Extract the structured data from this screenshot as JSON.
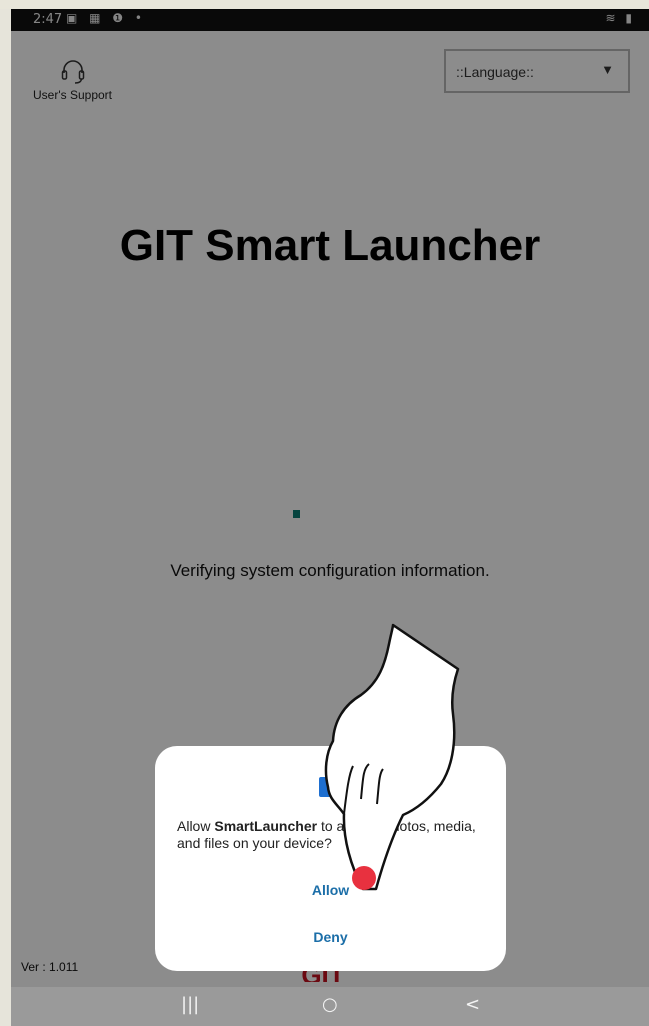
{
  "status_bar": {
    "time": "2:47",
    "left_icons": "▣ ▦ ❶ •",
    "right_icons": "≋ ▮"
  },
  "header": {
    "support_label": "User's Support",
    "language": {
      "selected": "::Language::"
    }
  },
  "main": {
    "title": "GIT Smart Launcher",
    "status_message": "Verifying system configuration information.",
    "version": "Ver : 1.011",
    "logo_text": "GIT"
  },
  "dialog": {
    "prompt_prefix": "Allow ",
    "app_name": "SmartLauncher",
    "prompt_suffix": " to access photos, media, and files on your device?",
    "allow_label": "Allow",
    "deny_label": "Deny"
  },
  "nav_bar": {
    "recents": "|||",
    "home": "○",
    "back": "<"
  },
  "colors": {
    "accent": "#1b6ea8",
    "spinner": "#0b7c74",
    "logo": "#c3111f",
    "touch_dot": "#e8313f"
  },
  "icons": [
    "headset-icon",
    "dropdown-arrow-icon",
    "folder-icon",
    "pointing-hand-icon"
  ]
}
